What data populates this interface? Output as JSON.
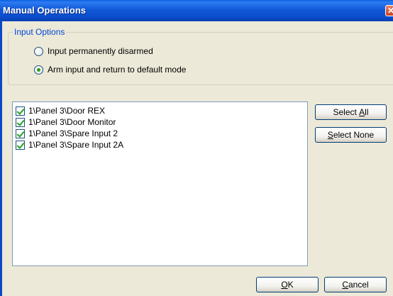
{
  "window": {
    "title": "Manual Operations",
    "close_glyph": "✕"
  },
  "input_options": {
    "legend": "Input Options",
    "options": [
      {
        "label": "Input permanently disarmed",
        "checked": false
      },
      {
        "label": "Arm input and return to default mode",
        "checked": true
      }
    ]
  },
  "inputs_list": [
    {
      "label": "1\\Panel 3\\Door REX",
      "checked": true
    },
    {
      "label": "1\\Panel 3\\Door Monitor",
      "checked": true
    },
    {
      "label": "1\\Panel 3\\Spare Input 2",
      "checked": true
    },
    {
      "label": "1\\Panel 3\\Spare Input 2A",
      "checked": true
    }
  ],
  "buttons": {
    "select_all": {
      "pre": "Select ",
      "accel": "A",
      "post": "ll"
    },
    "select_none": {
      "pre": "",
      "accel": "S",
      "post": "elect None"
    },
    "ok": {
      "pre": "",
      "accel": "O",
      "post": "K"
    },
    "cancel": {
      "pre": "",
      "accel": "C",
      "post": "ancel"
    }
  }
}
